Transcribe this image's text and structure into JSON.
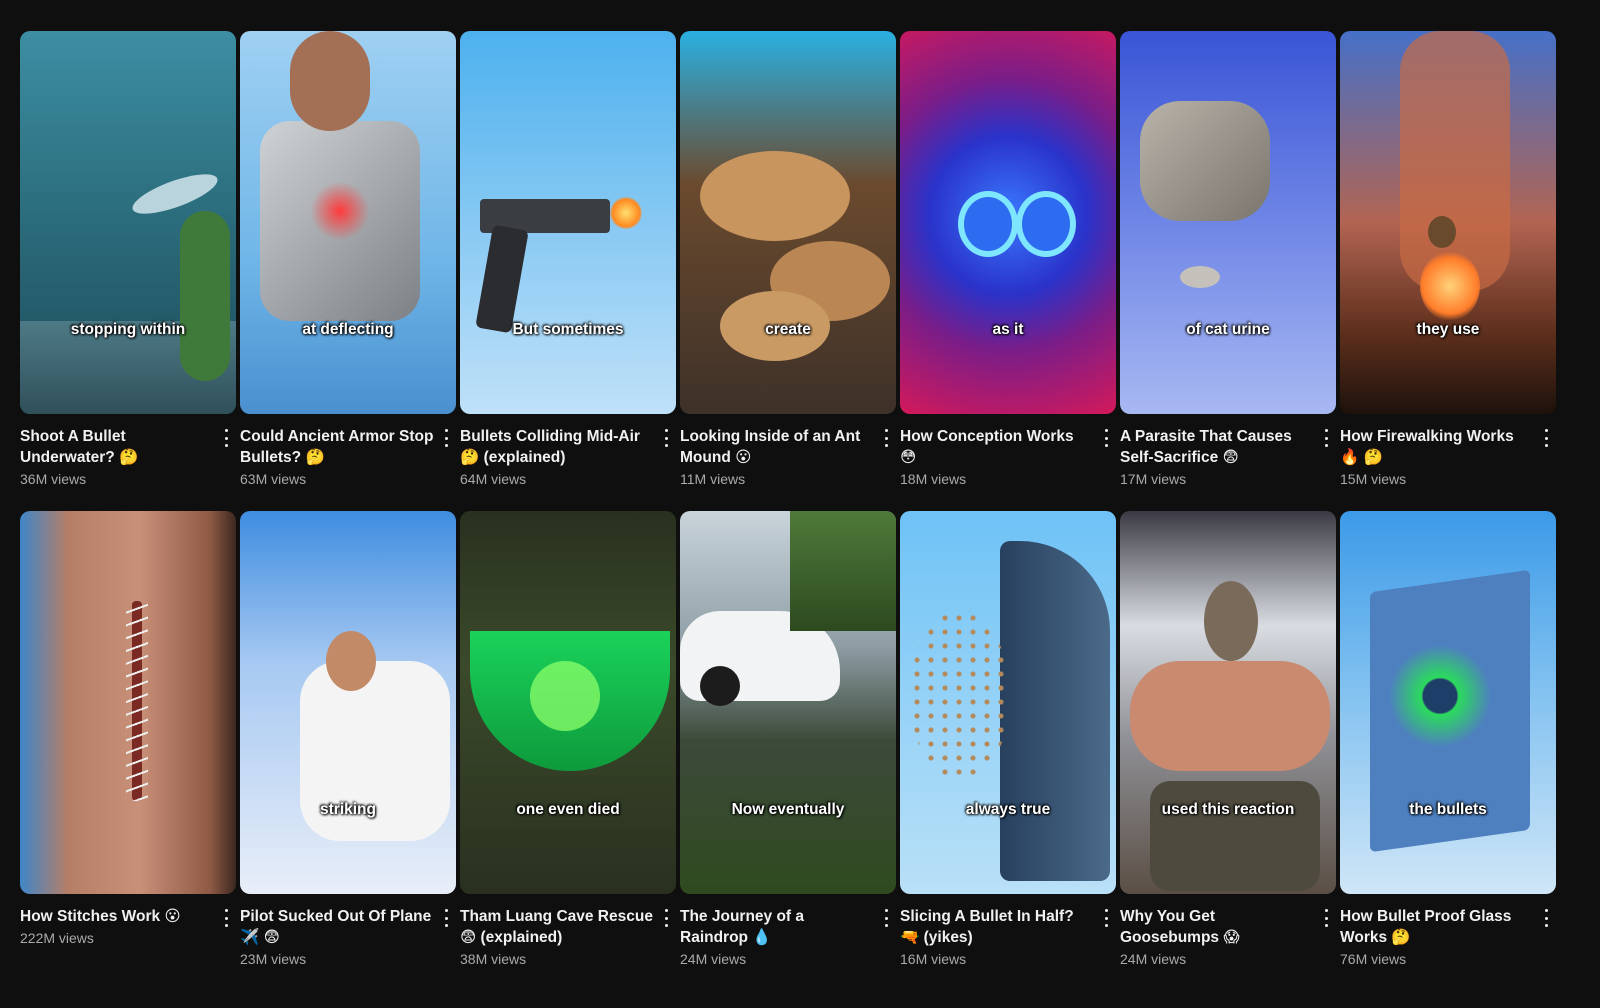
{
  "videos": [
    {
      "title": "Shoot A Bullet Underwater? 🤔",
      "views": "36M views",
      "caption": "stopping within",
      "bg": "linear-gradient(180deg,#3d8ea3 0%,#2c6f7f 45%,#1d4a58 100%)",
      "thumb_icon": "underwater-fish-scene"
    },
    {
      "title": "Could Ancient Armor Stop Bullets? 🤔",
      "views": "63M views",
      "caption": "at deflecting",
      "bg": "linear-gradient(180deg,#9fd0f2 0%,#6fb6e8 60%,#4a8fcf 100%)",
      "thumb_icon": "armored-man-scene"
    },
    {
      "title": "Bullets Colliding Mid-Air 🤔 (explained)",
      "views": "64M views",
      "caption": "But sometimes",
      "bg": "linear-gradient(180deg,#4db1ee 0%,#8dcbf4 55%,#bfe1f8 100%)",
      "thumb_icon": "pistol-firing-scene"
    },
    {
      "title": "Looking Inside of an Ant Mound 😮",
      "views": "11M views",
      "caption": "create",
      "bg": "linear-gradient(180deg,#2ab0e2 0%,#6b4a2e 40%,#3d3128 100%)",
      "thumb_icon": "ant-mound-scene"
    },
    {
      "title": "How Conception Works 😳",
      "views": "18M views",
      "caption": "as it",
      "bg": "radial-gradient(circle at 50% 48%,#3a7aff 0%,#2a32c9 35%,#7a1d88 60%,#d4195a 100%)",
      "thumb_icon": "cells-scene"
    },
    {
      "title": "A Parasite That Causes Self-Sacrifice 😨",
      "views": "17M views",
      "caption": "of cat urine",
      "bg": "linear-gradient(180deg,#3a55d6 0%,#6f86e6 50%,#a8b8f2 100%)",
      "thumb_icon": "cat-mouse-scene"
    },
    {
      "title": "How Firewalking Works 🔥 🤔",
      "views": "15M views",
      "caption": "they use",
      "bg": "linear-gradient(180deg,#4570c8 0%,#b26452 50%,#5a2d1a 80%,#1d120c 100%)",
      "thumb_icon": "firewalking-scene"
    },
    {
      "title": "How Stitches Work 😮",
      "views": "222M views",
      "caption": "",
      "bg": "linear-gradient(90deg,#3f86c8 0%,#b57e67 22%,#c99079 55%,#8f5a45 88%,#3b2820 100%)",
      "thumb_icon": "stitched-arm-scene"
    },
    {
      "title": "Pilot Sucked Out Of Plane ✈️ 😨",
      "views": "23M views",
      "caption": "striking",
      "bg": "linear-gradient(180deg,#3f8de0 0%,#a7c9f2 40%,#e8eef8 100%)",
      "thumb_icon": "falling-pilot-scene"
    },
    {
      "title": "Tham Luang Cave Rescue 😨 (explained)",
      "views": "38M views",
      "caption": "one even died",
      "bg": "linear-gradient(180deg,#28301f 0%,#3b4a2a 40%,#2a3020 100%)",
      "thumb_icon": "cave-diver-scene"
    },
    {
      "title": "The Journey of a Raindrop 💧",
      "views": "24M views",
      "caption": "Now eventually",
      "bg": "linear-gradient(180deg,#c9d4db 0%,#8f9ea6 35%,#3c4a3a 60%,#2f4a1f 100%)",
      "thumb_icon": "car-rain-scene"
    },
    {
      "title": "Slicing A Bullet In Half? 🔫 (yikes)",
      "views": "16M views",
      "caption": "always true",
      "bg": "linear-gradient(180deg,#6ec2f6 0%,#95d2f7 50%,#b9e0f7 100%)",
      "thumb_icon": "bullet-blade-scene"
    },
    {
      "title": "Why You Get Goosebumps 😱",
      "views": "24M views",
      "caption": "used this reaction",
      "bg": "linear-gradient(180deg,#3b3a44 0%,#d9dde2 30%,#8e8f95 60%,#5b4f45 100%)",
      "thumb_icon": "caveman-scene"
    },
    {
      "title": "How Bullet Proof Glass Works 🤔",
      "views": "76M views",
      "caption": "the bullets",
      "bg": "linear-gradient(180deg,#3c9ae8 0%,#7fc0f0 45%,#cfe6f7 100%)",
      "thumb_icon": "bulletproof-glass-scene"
    }
  ]
}
